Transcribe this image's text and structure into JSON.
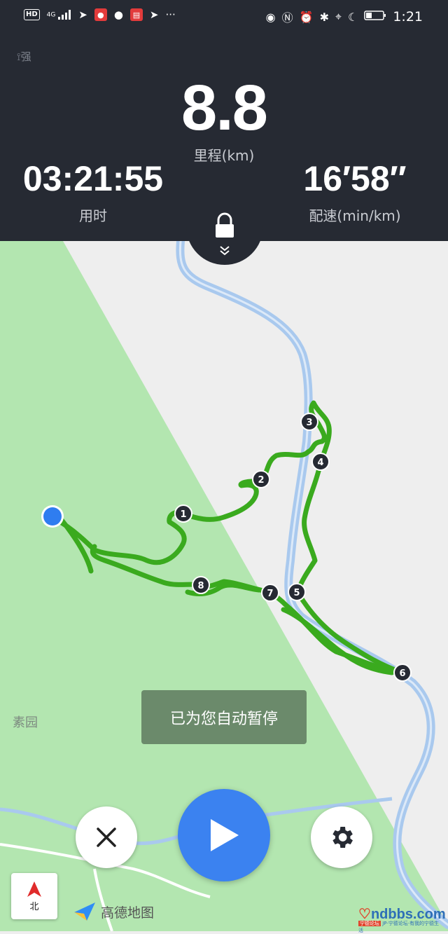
{
  "status_bar": {
    "network_label": "HD",
    "signal_label": "4G",
    "clock": "1:21",
    "left_icons": [
      "hd-icon",
      "signal-icon",
      "telegram-icon",
      "recorder-icon",
      "chat-icon",
      "calendar-icon",
      "telegram-icon",
      "more-icon"
    ],
    "right_icons": [
      "eye-icon",
      "nfc-icon",
      "alarm-icon",
      "bluetooth-icon",
      "location-icon",
      "moon-icon",
      "battery-icon"
    ]
  },
  "stats": {
    "gps_label": "强",
    "distance_value": "8.8",
    "distance_label": "里程(km)",
    "time_value": "03:21:55",
    "time_label": "用时",
    "pace_value": "16′58″",
    "pace_label": "配速(min/km)"
  },
  "map": {
    "place_label": "素园",
    "toast": "已为您自动暂停",
    "markers": [
      "1",
      "2",
      "3",
      "4",
      "5",
      "6",
      "7",
      "8"
    ],
    "compass_label": "北",
    "attribution": "高德地图",
    "colors": {
      "park": "#b3e6b0",
      "river": "#a9c9ee",
      "track": "#3aaa1e",
      "accent": "#3b82f0"
    }
  },
  "watermark": {
    "text": "ndbbs.com",
    "badge": "宁德论坛",
    "subtext": "JP·宁德论坛·有我的宁德生活"
  }
}
